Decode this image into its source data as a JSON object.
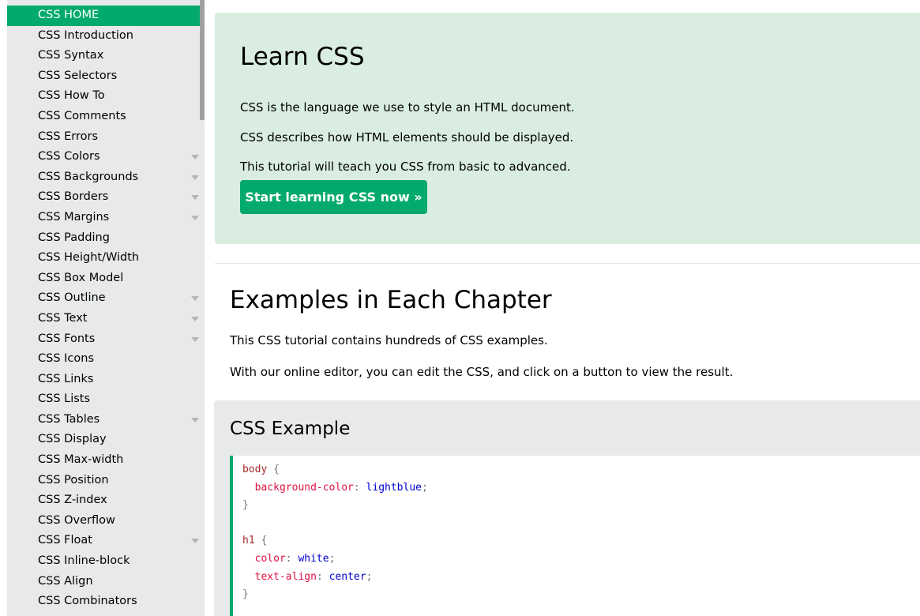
{
  "sidebar": {
    "items": [
      {
        "label": "CSS HOME",
        "active": true,
        "expandable": false
      },
      {
        "label": "CSS Introduction",
        "expandable": false
      },
      {
        "label": "CSS Syntax",
        "expandable": false
      },
      {
        "label": "CSS Selectors",
        "expandable": false
      },
      {
        "label": "CSS How To",
        "expandable": false
      },
      {
        "label": "CSS Comments",
        "expandable": false
      },
      {
        "label": "CSS Errors",
        "expandable": false
      },
      {
        "label": "CSS Colors",
        "expandable": true
      },
      {
        "label": "CSS Backgrounds",
        "expandable": true
      },
      {
        "label": "CSS Borders",
        "expandable": true
      },
      {
        "label": "CSS Margins",
        "expandable": true
      },
      {
        "label": "CSS Padding",
        "expandable": false
      },
      {
        "label": "CSS Height/Width",
        "expandable": false
      },
      {
        "label": "CSS Box Model",
        "expandable": false
      },
      {
        "label": "CSS Outline",
        "expandable": true
      },
      {
        "label": "CSS Text",
        "expandable": true
      },
      {
        "label": "CSS Fonts",
        "expandable": true
      },
      {
        "label": "CSS Icons",
        "expandable": false
      },
      {
        "label": "CSS Links",
        "expandable": false
      },
      {
        "label": "CSS Lists",
        "expandable": false
      },
      {
        "label": "CSS Tables",
        "expandable": true
      },
      {
        "label": "CSS Display",
        "expandable": false
      },
      {
        "label": "CSS Max-width",
        "expandable": false
      },
      {
        "label": "CSS Position",
        "expandable": false
      },
      {
        "label": "CSS Z-index",
        "expandable": false
      },
      {
        "label": "CSS Overflow",
        "expandable": false
      },
      {
        "label": "CSS Float",
        "expandable": true
      },
      {
        "label": "CSS Inline-block",
        "expandable": false
      },
      {
        "label": "CSS Align",
        "expandable": false
      },
      {
        "label": "CSS Combinators",
        "expandable": false
      }
    ]
  },
  "hero": {
    "title": "Learn CSS",
    "paragraphs": [
      "CSS is the language we use to style an HTML document.",
      "CSS describes how HTML elements should be displayed.",
      "This tutorial will teach you CSS from basic to advanced."
    ],
    "button_label": "Start learning CSS now »"
  },
  "examples": {
    "title": "Examples in Each Chapter",
    "paragraphs": [
      "This CSS tutorial contains hundreds of CSS examples.",
      "With our online editor, you can edit the CSS, and click on a button to view the result."
    ]
  },
  "css_example": {
    "title": "CSS Example",
    "rules": [
      {
        "selector": "body",
        "declarations": [
          {
            "property": "background-color",
            "value": "lightblue"
          }
        ]
      },
      {
        "selector": "h1",
        "declarations": [
          {
            "property": "color",
            "value": "white"
          },
          {
            "property": "text-align",
            "value": "center"
          }
        ]
      }
    ]
  },
  "colors": {
    "accent": "#04aa6d",
    "hero_bg": "#d9eee1",
    "sidebar_bg": "#e7e9eb"
  }
}
